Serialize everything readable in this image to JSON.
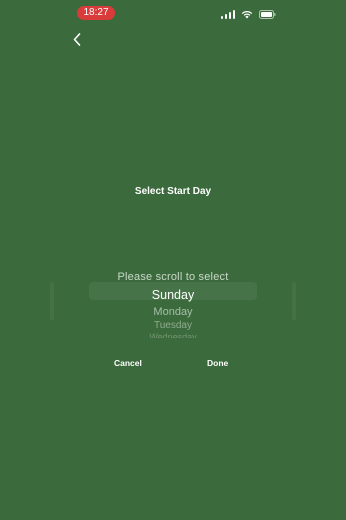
{
  "status_bar": {
    "time": "18:27",
    "time_pill_color": "#d93a3a",
    "icons": [
      "signal-icon",
      "wifi-icon",
      "battery-icon"
    ]
  },
  "nav": {
    "back_icon": "chevron-left-icon"
  },
  "dialog": {
    "title": "Select Start Day",
    "picker": {
      "prompt": "Please scroll to select",
      "selected": "Sunday",
      "items": [
        "Sunday",
        "Monday",
        "Tuesday",
        "Wednesday"
      ]
    },
    "cancel_label": "Cancel",
    "done_label": "Done"
  },
  "colors": {
    "background": "#3b6b3c",
    "text": "#ffffff"
  }
}
